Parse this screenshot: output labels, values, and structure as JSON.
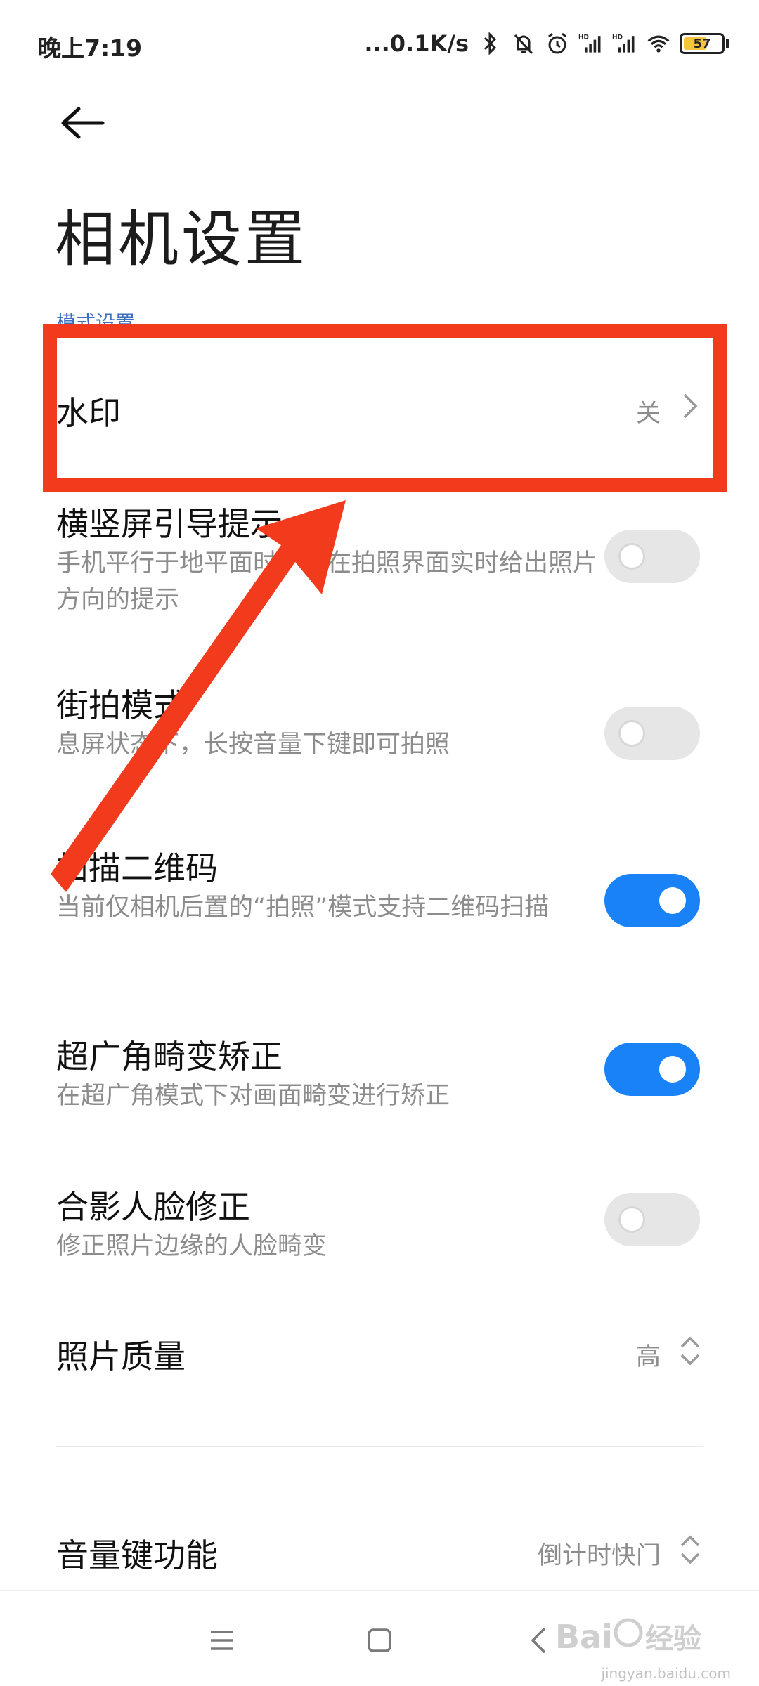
{
  "status_bar": {
    "time": "晚上7:19",
    "speed": "...0.1K/s",
    "battery_level": "57",
    "battery_color": "#f4c53c"
  },
  "header": {
    "title": "相机设置"
  },
  "section_label": "模式设置",
  "rows": {
    "watermark": {
      "title": "水印",
      "value": "关"
    },
    "orientation_hint": {
      "title": "横竖屏引导提示",
      "desc": "手机平行于地平面时，会在拍照界面实时给出照片方向的提示",
      "enabled": false
    },
    "street_mode": {
      "title": "街拍模式",
      "desc": "息屏状态下，长按音量下键即可拍照",
      "enabled": false
    },
    "qr_scan": {
      "title": "扫描二维码",
      "desc": "当前仅相机后置的“拍照”模式支持二维码扫描",
      "enabled": true
    },
    "ultrawide_correction": {
      "title": "超广角畸变矫正",
      "desc": "在超广角模式下对画面畸变进行矫正",
      "enabled": true
    },
    "group_face_correction": {
      "title": "合影人脸修正",
      "desc": "修正照片边缘的人脸畸变",
      "enabled": false
    },
    "photo_quality": {
      "title": "照片质量",
      "value": "高"
    },
    "volume_key": {
      "title": "音量键功能",
      "value": "倒计时快门"
    }
  },
  "colors": {
    "accent": "#1a82f7",
    "annotation": "#f23b1d",
    "toggle_off": "#e6e6e6"
  },
  "nav_icons": [
    "menu-icon",
    "home-icon",
    "back-icon"
  ],
  "watermark_logo": {
    "text": "Baidu经验",
    "sub": "jingyan.baidu.com"
  }
}
